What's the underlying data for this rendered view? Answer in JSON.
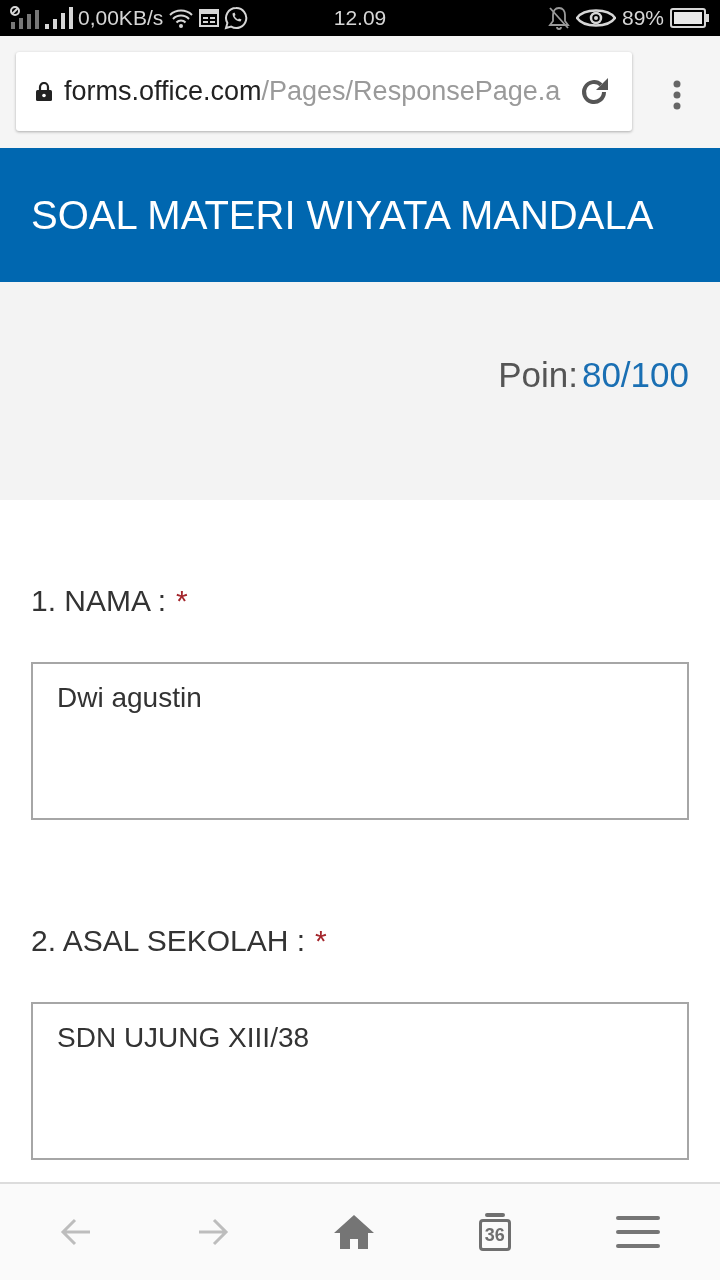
{
  "status_bar": {
    "network_speed": "0,00KB/s",
    "time": "12.09",
    "battery": "89%"
  },
  "browser": {
    "url": {
      "host": "forms.office.com",
      "path": "/Pages/ResponsePage.a"
    }
  },
  "form": {
    "title": "SOAL MATERI WIYATA MANDALA",
    "score": {
      "label": "Poin:",
      "value": "80/100"
    },
    "questions": [
      {
        "title": "1. NAMA :",
        "required_mark": "*",
        "value": "Dwi agustin"
      },
      {
        "title": "2. ASAL SEKOLAH :",
        "required_mark": "*",
        "value": "SDN UJUNG XIII/38"
      }
    ]
  },
  "bottom_nav": [
    {
      "kind": "back",
      "disabled": true
    },
    {
      "kind": "forward",
      "disabled": true
    },
    {
      "kind": "home",
      "disabled": false
    },
    {
      "kind": "tabs",
      "count": "36",
      "disabled": false
    },
    {
      "kind": "menu",
      "disabled": false
    }
  ]
}
